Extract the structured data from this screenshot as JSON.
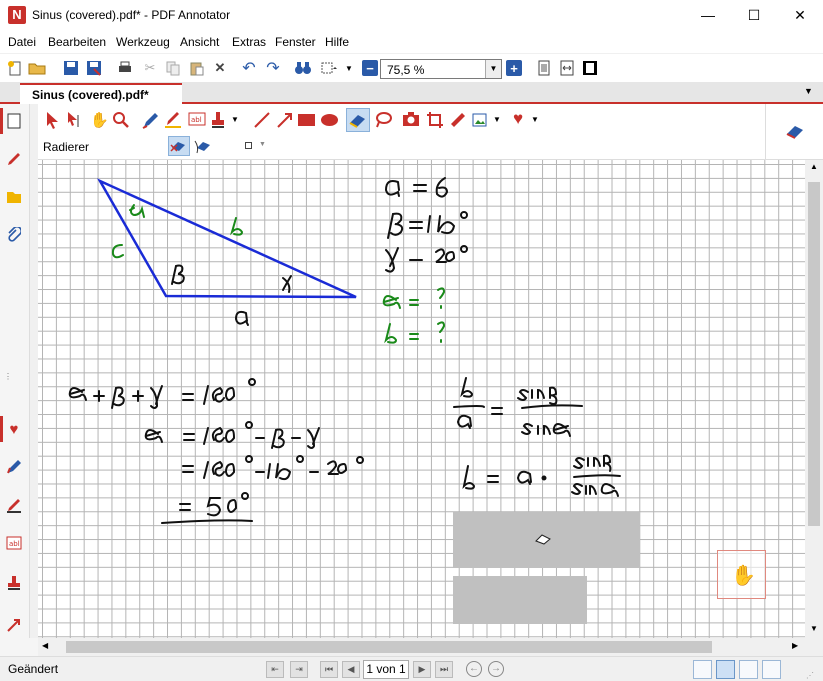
{
  "window": {
    "title": "Sinus (covered).pdf* - PDF Annotator",
    "minimize": "—",
    "maximize": "☐",
    "close": "✕"
  },
  "menu": [
    "Datei",
    "Bearbeiten",
    "Werkzeug",
    "Ansicht",
    "Extras",
    "Fenster",
    "Hilfe"
  ],
  "toolbar": {
    "zoom_value": "75,5 %"
  },
  "tab": {
    "label": "Sinus (covered).pdf*"
  },
  "tool_panel": {
    "current_tool_label": "Radierer"
  },
  "status": {
    "left_text": "Geändert",
    "page_field": "1 von 1"
  },
  "colors": {
    "accent": "#c8302b",
    "ink_black": "#111111",
    "ink_blue": "#1a2bd6",
    "ink_green": "#1a8a1a",
    "cover_gray": "#c0c0c0"
  },
  "handwriting": {
    "given": [
      "a = 6",
      "β = 110°",
      "γ = 20°"
    ],
    "unknown": [
      "α = ?",
      "b = ?"
    ],
    "triangle_labels": [
      "α",
      "b",
      "c",
      "β",
      "γ",
      "a"
    ],
    "angle_sum": [
      "α + β + γ = 180°",
      "α = 180° − β − γ",
      "= 180° − 110° − 20°",
      "= 50°"
    ],
    "law_of_sines": [
      "b/a = sin β/sin α",
      "b = a · sin β/sin α"
    ]
  }
}
